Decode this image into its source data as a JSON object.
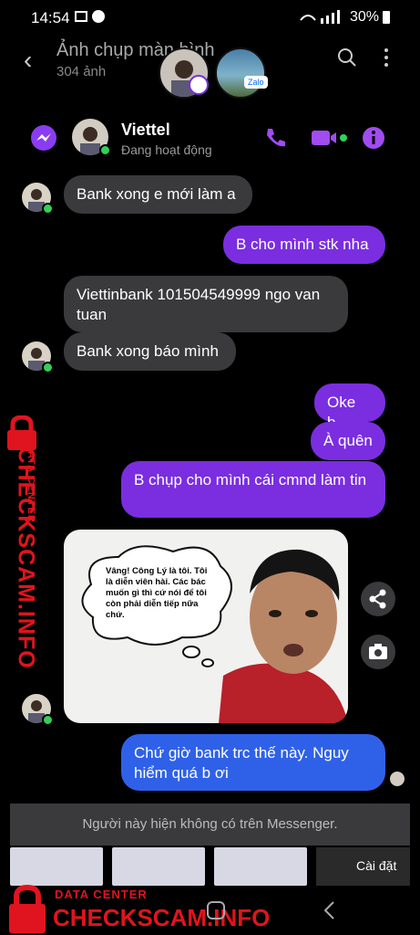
{
  "status_bar": {
    "time": "14:54",
    "battery": "30%"
  },
  "gallery": {
    "title": "Ảnh chụp màn hình",
    "count": "304 ảnh",
    "zalo_label": "Zalo"
  },
  "contact": {
    "name": "Viettel",
    "status": "Đang hoạt động"
  },
  "messages": [
    {
      "side": "left",
      "text": "Bank xong e mới làm a"
    },
    {
      "side": "right",
      "text": "B cho mình stk nha"
    },
    {
      "side": "left",
      "text": "Viettinbank 101504549999 ngo van tuan"
    },
    {
      "side": "left",
      "text": "Bank xong báo mình"
    },
    {
      "side": "right",
      "text": "Oke b."
    },
    {
      "side": "right",
      "text": "À quên"
    },
    {
      "side": "right",
      "text": "B chụp cho mình cái cmnd làm tin"
    },
    {
      "side": "right",
      "text": "Chứ giờ bank trc thế này. Nguy hiểm quá b ơi"
    }
  ],
  "meme": {
    "caption": "Vâng! Công Lý là tôi. Tôi là diễn viên hài. Các bác muốn gì thì cứ nói để tôi còn phải diễn tiếp nữa chứ."
  },
  "notice": "Người này hiện không có trên Messenger.",
  "install_label": "Cài đặt",
  "watermark": {
    "line1": "DATA CENTER",
    "line2": "CHECKSCAM.INFO"
  },
  "colors": {
    "accent": "#7a2ee0",
    "online": "#31d158",
    "watermark": "#e0141e"
  }
}
